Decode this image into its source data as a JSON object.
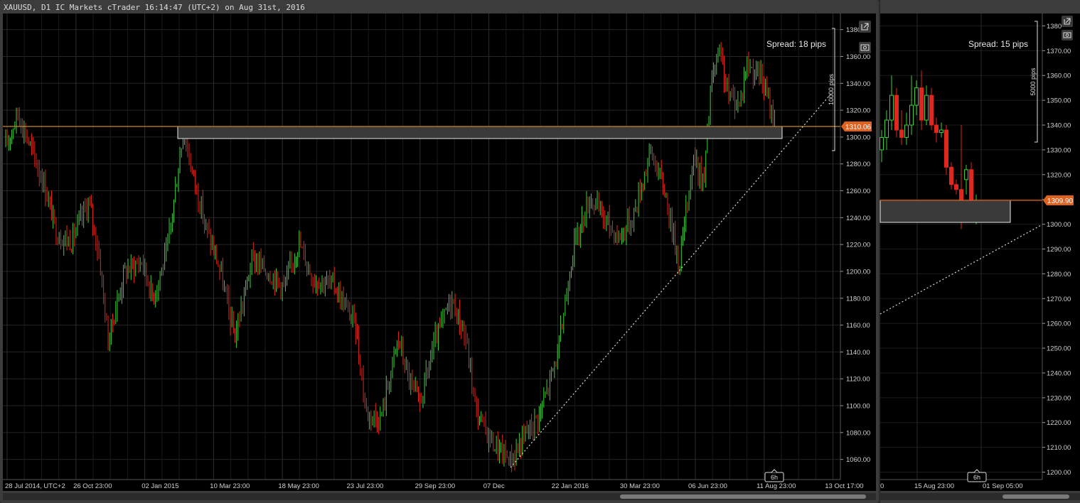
{
  "main_chart": {
    "title": "XAUUSD, D1 IC Markets cTrader 16:14:47 (UTC+2) on Aug 31st, 2016",
    "spread": "Spread: 18 pips",
    "scale_label": "10000 pips",
    "current_price": "1310.06",
    "timeframe_marker": "6h",
    "price_ticks": [
      "1380.00",
      "1360.00",
      "1340.00",
      "1320.00",
      "1300.00",
      "1280.00",
      "1260.00",
      "1240.00",
      "1220.00",
      "1200.00",
      "1180.00",
      "1160.00",
      "1140.00",
      "1120.00",
      "1100.00",
      "1080.00",
      "1060.00"
    ],
    "date_ticks": [
      "28 Jul 2014, UTC+2",
      "26 Oct 23:00",
      "02 Jan 2015",
      "10 Mar 23:00",
      "18 May 23:00",
      "23 Jul 23:00",
      "29 Sep 23:00",
      "07 Dec",
      "22 Jan 2016",
      "30 Mar 23:00",
      "06 Jun 23:00",
      "11 Aug 23:00",
      "13 Oct 17:00"
    ],
    "icons": [
      "popout-icon",
      "camera-icon"
    ]
  },
  "side_chart": {
    "spread": "Spread: 15 pips",
    "scale_label": "5000 pips",
    "current_price": "1309.90",
    "timeframe_marker": "6h",
    "price_ticks": [
      "1380",
      "1370.00",
      "1360.00",
      "1350.00",
      "1340.00",
      "1330.00",
      "1320.00",
      "1310.00",
      "1300.00",
      "1290.00",
      "1280.00",
      "1270.00",
      "1260.00",
      "1250.00",
      "1240.00",
      "1230.00",
      "1220.00",
      "1210.00",
      "1200.00"
    ],
    "date_ticks": [
      "0",
      "15 Aug 23:00",
      "01 Sep 05:00"
    ],
    "icons": [
      "popout-icon",
      "camera-icon"
    ]
  },
  "colors": {
    "bull": "#3bd13b",
    "bear": "#e0261e",
    "price_line": "#c8862b",
    "price_tag": "#e0601e",
    "background": "#000000"
  },
  "chart_data": [
    {
      "type": "candlestick",
      "symbol": "XAUUSD",
      "timeframe": "D1",
      "ylim": [
        1045,
        1392
      ],
      "x": [
        "28 Jul 2014",
        "26 Oct",
        "02 Jan 2015",
        "10 Mar",
        "18 May",
        "23 Jul",
        "29 Sep",
        "07 Dec",
        "22 Jan 2016",
        "30 Mar",
        "06 Jun",
        "11 Aug",
        "31 Aug 2016"
      ],
      "close": [
        1293,
        1205,
        1290,
        1195,
        1200,
        1098,
        1180,
        1060,
        1110,
        1245,
        1250,
        1345,
        1310
      ],
      "last_price": 1310.06,
      "support_zone": [
        1301,
        1310
      ]
    },
    {
      "type": "candlestick",
      "symbol": "XAUUSD",
      "timeframe": "H6",
      "ylim": [
        1197,
        1385
      ],
      "last_price": 1309.9,
      "support_zone": [
        1300,
        1309
      ]
    }
  ]
}
